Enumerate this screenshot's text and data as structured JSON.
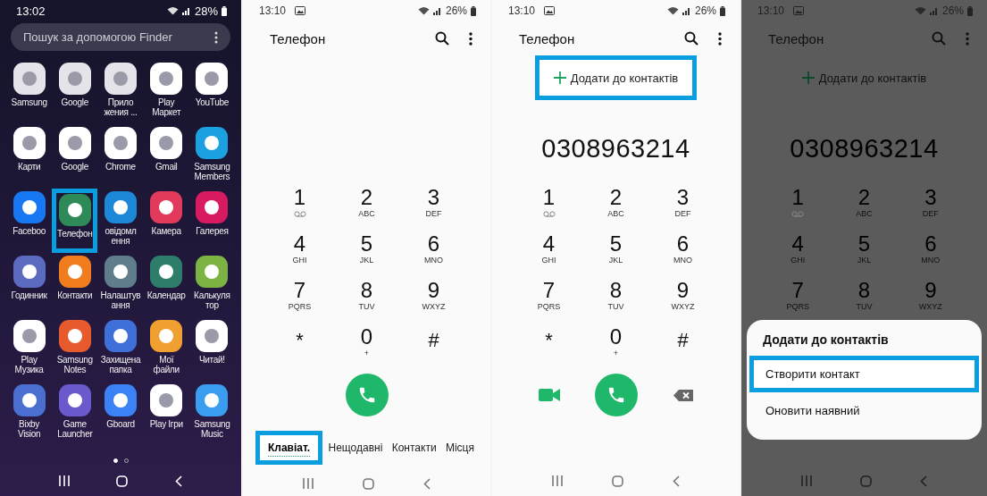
{
  "screens": [
    {
      "kind": "home",
      "status": {
        "time": "13:02",
        "battery": "28%",
        "notification_icon": false
      },
      "search": {
        "placeholder": "Пошук за допомогою Finder"
      },
      "apps": [
        {
          "label": "Samsung",
          "color": "#e4e4ea",
          "highlighted": false
        },
        {
          "label": "Google",
          "color": "#e4e4ea",
          "highlighted": false
        },
        {
          "label": "Прило\nжения ...",
          "color": "#e4e4ea",
          "highlighted": false
        },
        {
          "label": "Play\nМаркет",
          "color": "#ffffff",
          "highlighted": false
        },
        {
          "label": "YouTube",
          "color": "#ffffff",
          "highlighted": false
        },
        {
          "label": "Карти",
          "color": "#ffffff",
          "highlighted": false
        },
        {
          "label": "Google",
          "color": "#ffffff",
          "highlighted": false
        },
        {
          "label": "Chrome",
          "color": "#ffffff",
          "highlighted": false
        },
        {
          "label": "Gmail",
          "color": "#ffffff",
          "highlighted": false
        },
        {
          "label": "Samsung\nMembers",
          "color": "#1ba1e2",
          "highlighted": false
        },
        {
          "label": "Faceboo",
          "color": "#1877f2",
          "highlighted": false
        },
        {
          "label": "Телефон",
          "color": "#2e8b57",
          "highlighted": true
        },
        {
          "label": "овідомл\nення",
          "color": "#1e88d8",
          "highlighted": false
        },
        {
          "label": "Камера",
          "color": "#e23a5a",
          "highlighted": false
        },
        {
          "label": "Галерея",
          "color": "#d81b60",
          "highlighted": false
        },
        {
          "label": "Годинник",
          "color": "#5c6bc0",
          "highlighted": false
        },
        {
          "label": "Контакти",
          "color": "#f07c1e",
          "highlighted": false
        },
        {
          "label": "Налаштув\nання",
          "color": "#607d8b",
          "highlighted": false
        },
        {
          "label": "Календар",
          "color": "#2e7d6b",
          "highlighted": false
        },
        {
          "label": "Калькуля\nтор",
          "color": "#7cb342",
          "highlighted": false
        },
        {
          "label": "Play\nМузика",
          "color": "#ffffff",
          "highlighted": false
        },
        {
          "label": "Samsung\nNotes",
          "color": "#e65a2e",
          "highlighted": false
        },
        {
          "label": "Захищена\nпапка",
          "color": "#3f6fd8",
          "highlighted": false
        },
        {
          "label": "Мої\nфайли",
          "color": "#f0a030",
          "highlighted": false
        },
        {
          "label": "Читай!",
          "color": "#ffffff",
          "highlighted": false
        },
        {
          "label": "Bixby\nVision",
          "color": "#4a6fd0",
          "highlighted": false
        },
        {
          "label": "Game\nLauncher",
          "color": "#6a5acd",
          "highlighted": false
        },
        {
          "label": "Gboard",
          "color": "#3b82f6",
          "highlighted": false
        },
        {
          "label": "Play Ігри",
          "color": "#ffffff",
          "highlighted": false
        },
        {
          "label": "Samsung\nMusic",
          "color": "#3b9df0",
          "highlighted": false
        }
      ],
      "page_dots": [
        {
          "selected": true
        },
        {
          "selected": false
        }
      ]
    },
    {
      "kind": "dialer",
      "dimmed": false,
      "status": {
        "time": "13:10",
        "battery": "26%",
        "notification_icon": true
      },
      "title": "Телефон",
      "keys": [
        {
          "digit": "1",
          "kind": "voicemail"
        },
        {
          "digit": "2",
          "letters": "ABC"
        },
        {
          "digit": "3",
          "letters": "DEF"
        },
        {
          "digit": "4",
          "letters": "GHI"
        },
        {
          "digit": "5",
          "letters": "JKL"
        },
        {
          "digit": "6",
          "letters": "MNO"
        },
        {
          "digit": "7",
          "letters": "PQRS"
        },
        {
          "digit": "8",
          "letters": "TUV"
        },
        {
          "digit": "9",
          "letters": "WXYZ"
        },
        {
          "digit": "*"
        },
        {
          "digit": "0",
          "letters": "+"
        },
        {
          "digit": "#"
        }
      ],
      "actions": [
        {
          "kind": "call"
        }
      ],
      "tabs": [
        {
          "label": "Клавіат.",
          "selected": true,
          "highlighted": true
        },
        {
          "label": "Нещодавні",
          "selected": false,
          "highlighted": false
        },
        {
          "label": "Контакти",
          "selected": false,
          "highlighted": false
        },
        {
          "label": "Місця",
          "selected": false,
          "highlighted": false
        }
      ]
    },
    {
      "kind": "dialer",
      "dimmed": false,
      "status": {
        "time": "13:10",
        "battery": "26%",
        "notification_icon": true
      },
      "title": "Телефон",
      "add_link": {
        "label": "Додати до контактів",
        "highlighted": true
      },
      "number": "0308963214",
      "keys": [
        {
          "digit": "1",
          "kind": "voicemail"
        },
        {
          "digit": "2",
          "letters": "ABC"
        },
        {
          "digit": "3",
          "letters": "DEF"
        },
        {
          "digit": "4",
          "letters": "GHI"
        },
        {
          "digit": "5",
          "letters": "JKL"
        },
        {
          "digit": "6",
          "letters": "MNO"
        },
        {
          "digit": "7",
          "letters": "PQRS"
        },
        {
          "digit": "8",
          "letters": "TUV"
        },
        {
          "digit": "9",
          "letters": "WXYZ"
        },
        {
          "digit": "*"
        },
        {
          "digit": "0",
          "letters": "+"
        },
        {
          "digit": "#"
        }
      ],
      "actions": [
        {
          "kind": "video"
        },
        {
          "kind": "call"
        },
        {
          "kind": "backspace"
        }
      ]
    },
    {
      "kind": "dialer",
      "dimmed": true,
      "status": {
        "time": "13:10",
        "battery": "26%",
        "notification_icon": true
      },
      "title": "Телефон",
      "add_link": {
        "label": "Додати до контактів",
        "highlighted": false
      },
      "number": "0308963214",
      "keys": [
        {
          "digit": "1",
          "kind": "voicemail"
        },
        {
          "digit": "2",
          "letters": "ABC"
        },
        {
          "digit": "3",
          "letters": "DEF"
        },
        {
          "digit": "4",
          "letters": "GHI"
        },
        {
          "digit": "5",
          "letters": "JKL"
        },
        {
          "digit": "6",
          "letters": "MNO"
        },
        {
          "digit": "7",
          "letters": "PQRS"
        },
        {
          "digit": "8",
          "letters": "TUV"
        },
        {
          "digit": "9",
          "letters": "WXYZ"
        }
      ],
      "sheet": {
        "title": "Додати до контактів",
        "options": [
          {
            "label": "Створити контакт",
            "highlighted": true
          },
          {
            "label": "Оновити наявний",
            "highlighted": false
          }
        ]
      }
    }
  ]
}
